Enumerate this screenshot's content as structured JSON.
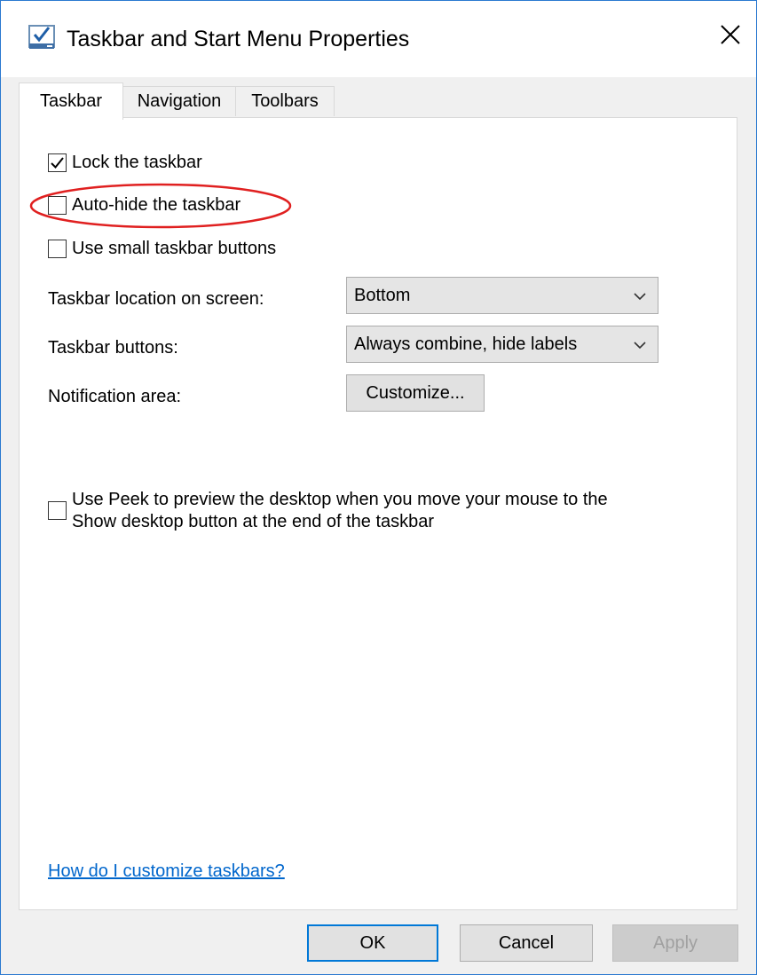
{
  "window": {
    "title": "Taskbar and Start Menu Properties",
    "app_icon": "taskbar-properties-icon",
    "close_icon": "close-icon",
    "accent_color": "#2b79d0"
  },
  "tabs": [
    {
      "label": "Taskbar",
      "active": true
    },
    {
      "label": "Navigation",
      "active": false
    },
    {
      "label": "Toolbars",
      "active": false
    }
  ],
  "taskbar": {
    "lock": {
      "label": "Lock the taskbar",
      "checked": true
    },
    "autohide": {
      "label": "Auto-hide the taskbar",
      "checked": false,
      "highlight_color": "#e02020"
    },
    "small_buttons": {
      "label": "Use small taskbar buttons",
      "checked": false
    },
    "location": {
      "label": "Taskbar location on screen:",
      "value": "Bottom"
    },
    "buttons": {
      "label": "Taskbar buttons:",
      "value": "Always combine, hide labels"
    },
    "notification": {
      "label": "Notification area:",
      "button": "Customize..."
    },
    "peek": {
      "line1": "Use Peek to preview the desktop when you move your mouse to the",
      "line2": "Show desktop button at the end of the taskbar",
      "checked": false
    },
    "help_link": "How do I customize taskbars?"
  },
  "footer": {
    "ok": "OK",
    "cancel": "Cancel",
    "apply": "Apply"
  }
}
